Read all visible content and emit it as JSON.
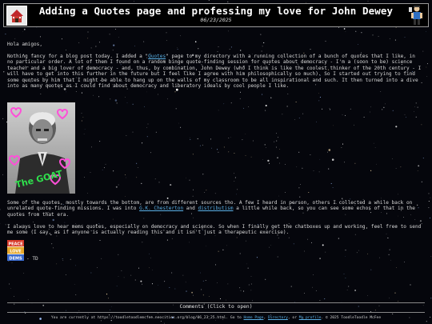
{
  "header": {
    "title": "Adding a Quotes page and professing my love for John Dewey",
    "date": "06/23/2025",
    "home_icon": "home-icon",
    "mascot_icon": "mascot-icon"
  },
  "post": {
    "greeting": "Hola amigos,",
    "p1_a": "Nothing fancy for a blog post today. I added a \"",
    "p1_link": "Quotes",
    "p1_b": "\" page to my directory with a running collection of a bunch of quotes that I like, in no particular order. A lot of them I found on a random binge quote-finding session for quotes about democracy - I'm a (soon to be) science teacher and a big lover of democracy - and, thus, by combination, John Dewey (who I think is like the coolest thinker of the 20th century - I will have to get into this further in the future but I feel like I agree with him philosophically so much). So I started out trying to find some quotes by him that I might be able to hang up on the walls of my classroom to be all inspirational and such. It then turned into a dive into as many quotes as I could find about democracy and liberatory ideals by cool people I like.",
    "p2_a": "Some of the quotes, mostly towards the bottom, are from different sources tho. A few I heard in person, others I collected a while back on unrelated quote-finding missions. I was into ",
    "p2_link1": "G.K. Chesterton",
    "p2_mid": " and ",
    "p2_link2": "distributism",
    "p2_b": " a little while back, so you can see some echos of that in the quotes from that era.",
    "p3": "I always love to hear mems quotes, especially on democracy and science. So when I finally get the chatboxes up and working, feel free to send me some (I say, as if anyone is actually reading this and it isn't just a therapeutic exercise).",
    "signoff": "- TD",
    "portrait_caption": "The GOAT",
    "badge_text": "PEACE LOVE DEMS"
  },
  "comments": {
    "toggle_label": "Comments (Click to open)"
  },
  "footer": {
    "text_a": "You are currently at https://toodletoodlemcfee.neocities.org/blog/06_23_25.html. Go to ",
    "link_home": "Home Page",
    "text_b": ", ",
    "link_directory": "Directory",
    "text_c": ", or ",
    "link_profile": "My profile",
    "text_d": ". © 2025 ToodleToodle McFee"
  },
  "colors": {
    "background": "#05060c",
    "link": "#5ab0e6",
    "heart": "#ff4fd8",
    "caption": "#2fe04c"
  }
}
